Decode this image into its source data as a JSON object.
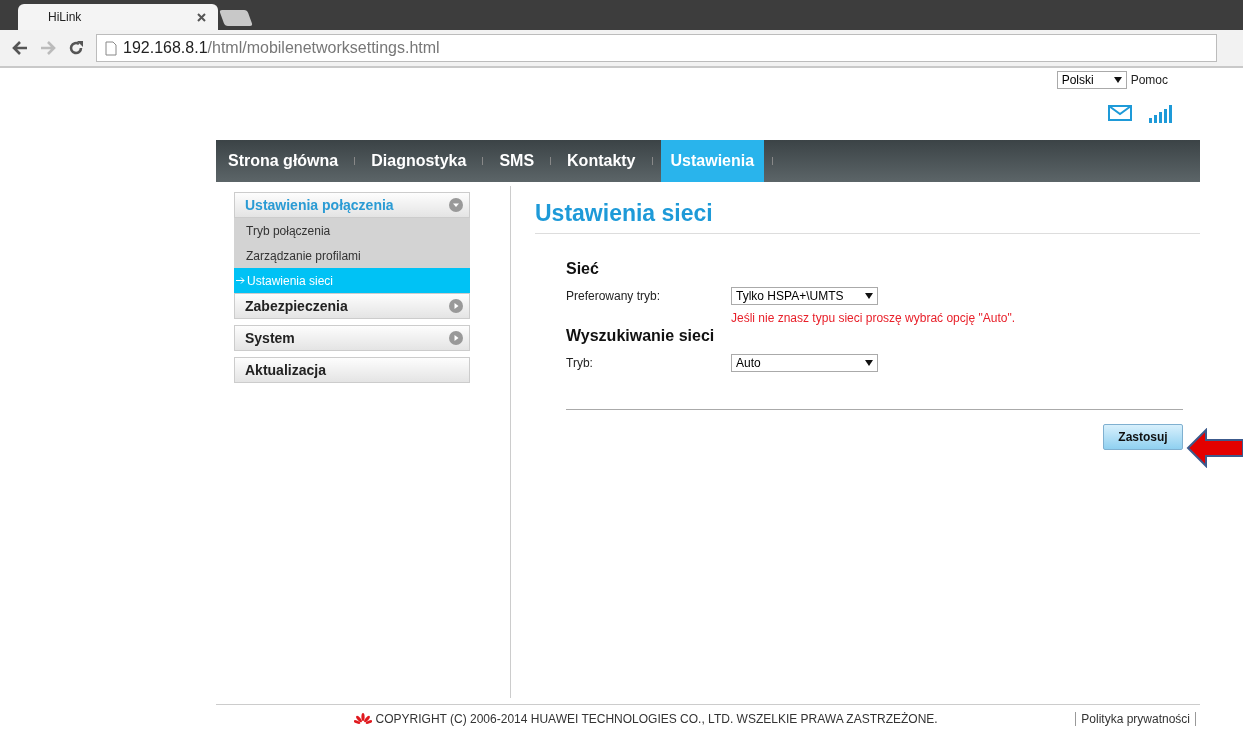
{
  "browser": {
    "tab_title": "HiLink",
    "address_host": "192.168.8.1",
    "address_path": "/html/mobilenetworksettings.html"
  },
  "header": {
    "language": "Polski",
    "help": "Pomoc"
  },
  "nav": [
    {
      "label": "Strona główna",
      "selected": false
    },
    {
      "label": "Diagnostyka",
      "selected": false
    },
    {
      "label": "SMS",
      "selected": false
    },
    {
      "label": "Kontakty",
      "selected": false
    },
    {
      "label": "Ustawienia",
      "selected": true
    }
  ],
  "sidebar": [
    {
      "kind": "group",
      "label": "Ustawienia połączenia",
      "expanded": true,
      "children": [
        {
          "label": "Tryb połączenia",
          "selected": false
        },
        {
          "label": "Zarządzanie profilami",
          "selected": false
        },
        {
          "label": "Ustawienia sieci",
          "selected": true
        }
      ]
    },
    {
      "kind": "group",
      "label": "Zabezpieczenia",
      "expanded": false
    },
    {
      "kind": "group",
      "label": "System",
      "expanded": false
    },
    {
      "kind": "link",
      "label": "Aktualizacja"
    }
  ],
  "page_title": "Ustawienia sieci",
  "sections": [
    {
      "heading": "Sieć",
      "fields": [
        {
          "label": "Preferowany tryb:",
          "value": "Tylko HSPA+\\UMTS",
          "note": "Jeśli nie znasz typu sieci proszę wybrać opcję \"Auto\"."
        }
      ]
    },
    {
      "heading": "Wyszukiwanie sieci",
      "fields": [
        {
          "label": "Tryb:",
          "value": "Auto"
        }
      ]
    }
  ],
  "apply_button": "Zastosuj",
  "footer": {
    "copyright": "COPYRIGHT (C) 2006-2014 HUAWEI TECHNOLOGIES CO., LTD. WSZELKIE PRAWA ZASTRZEŻONE.",
    "privacy": "Polityka prywatności"
  }
}
